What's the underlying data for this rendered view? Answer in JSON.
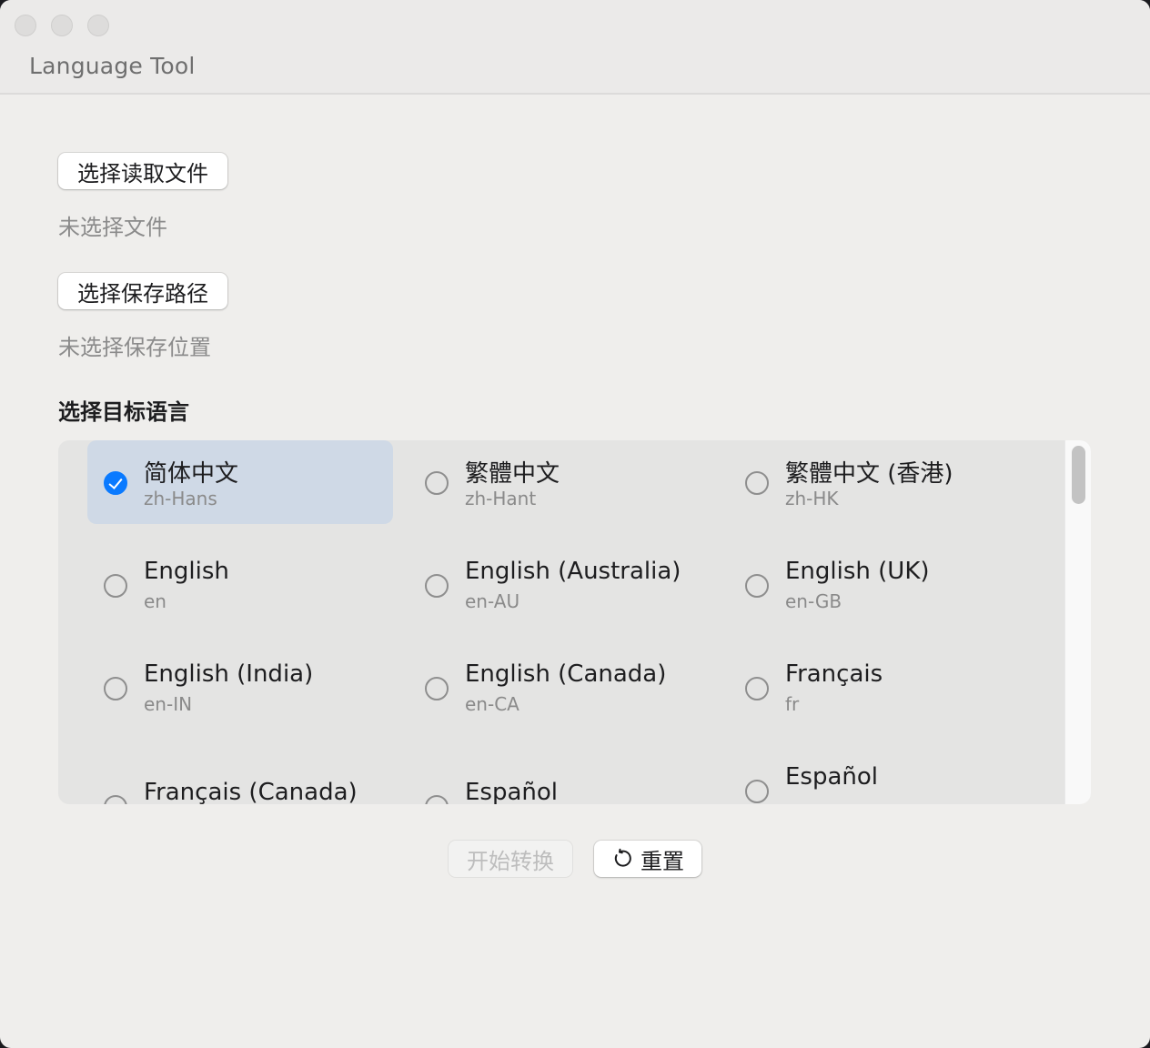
{
  "window": {
    "title": "Language Tool"
  },
  "file": {
    "choose_read_label": "选择读取文件",
    "read_status": "未选择文件",
    "choose_save_label": "选择保存路径",
    "save_status": "未选择保存位置"
  },
  "target_language": {
    "label": "选择目标语言",
    "selected_code": "zh-Hans",
    "options": [
      {
        "name": "简体中文",
        "code": "zh-Hans",
        "selected": true
      },
      {
        "name": "繁體中文",
        "code": "zh-Hant",
        "selected": false
      },
      {
        "name": "繁體中文 (香港)",
        "code": "zh-HK",
        "selected": false
      },
      {
        "name": "English",
        "code": "en",
        "selected": false
      },
      {
        "name": "English (Australia)",
        "code": "en-AU",
        "selected": false
      },
      {
        "name": "English (UK)",
        "code": "en-GB",
        "selected": false
      },
      {
        "name": "English (India)",
        "code": "en-IN",
        "selected": false
      },
      {
        "name": "English (Canada)",
        "code": "en-CA",
        "selected": false
      },
      {
        "name": "Français",
        "code": "fr",
        "selected": false
      },
      {
        "name": "Français (Canada)",
        "code": "",
        "selected": false
      },
      {
        "name": "Español",
        "code": "",
        "selected": false
      },
      {
        "name": "Español",
        "code": "",
        "selected": false
      }
    ]
  },
  "actions": {
    "start_label": "开始转换",
    "start_enabled": false,
    "reset_label": "重置",
    "reset_icon": "reset-icon"
  },
  "colors": {
    "accent": "#0a7aff",
    "selection_bg": "#cfd9e6"
  }
}
